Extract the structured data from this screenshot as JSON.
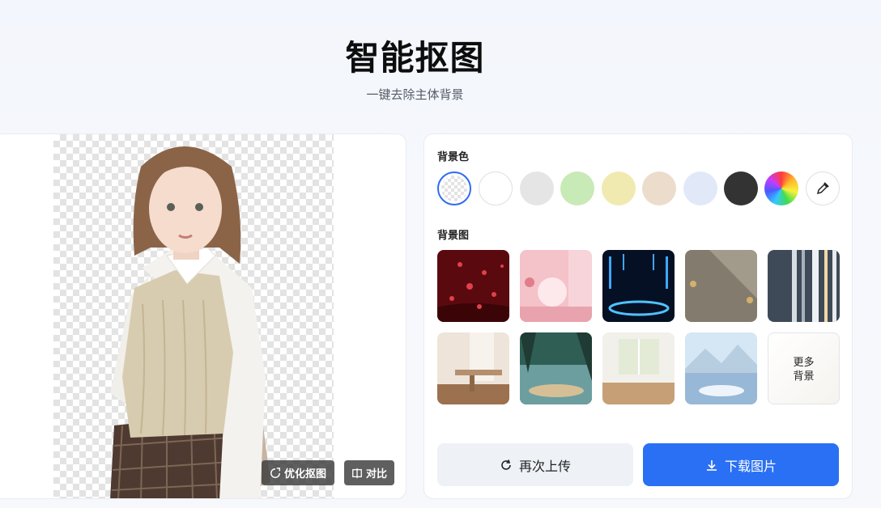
{
  "header": {
    "title": "智能抠图",
    "subtitle": "一键去除主体背景"
  },
  "preview": {
    "refine_label": "优化抠图",
    "compare_label": "对比"
  },
  "panel": {
    "bg_color_label": "背景色",
    "bg_image_label": "背景图",
    "colors": [
      "transparent",
      "#ffffff",
      "#e5e5e5",
      "#c8eab6",
      "#f0eab0",
      "#ecdccc",
      "#e1e9f8",
      "#333333",
      "rainbow",
      "eyedropper"
    ],
    "more_label_line1": "更多",
    "more_label_line2": "背景",
    "reupload_label": "再次上传",
    "download_label": "下载图片"
  },
  "colors": {
    "accent": "#2f6bf2",
    "primary_button": "#2a70f5"
  }
}
